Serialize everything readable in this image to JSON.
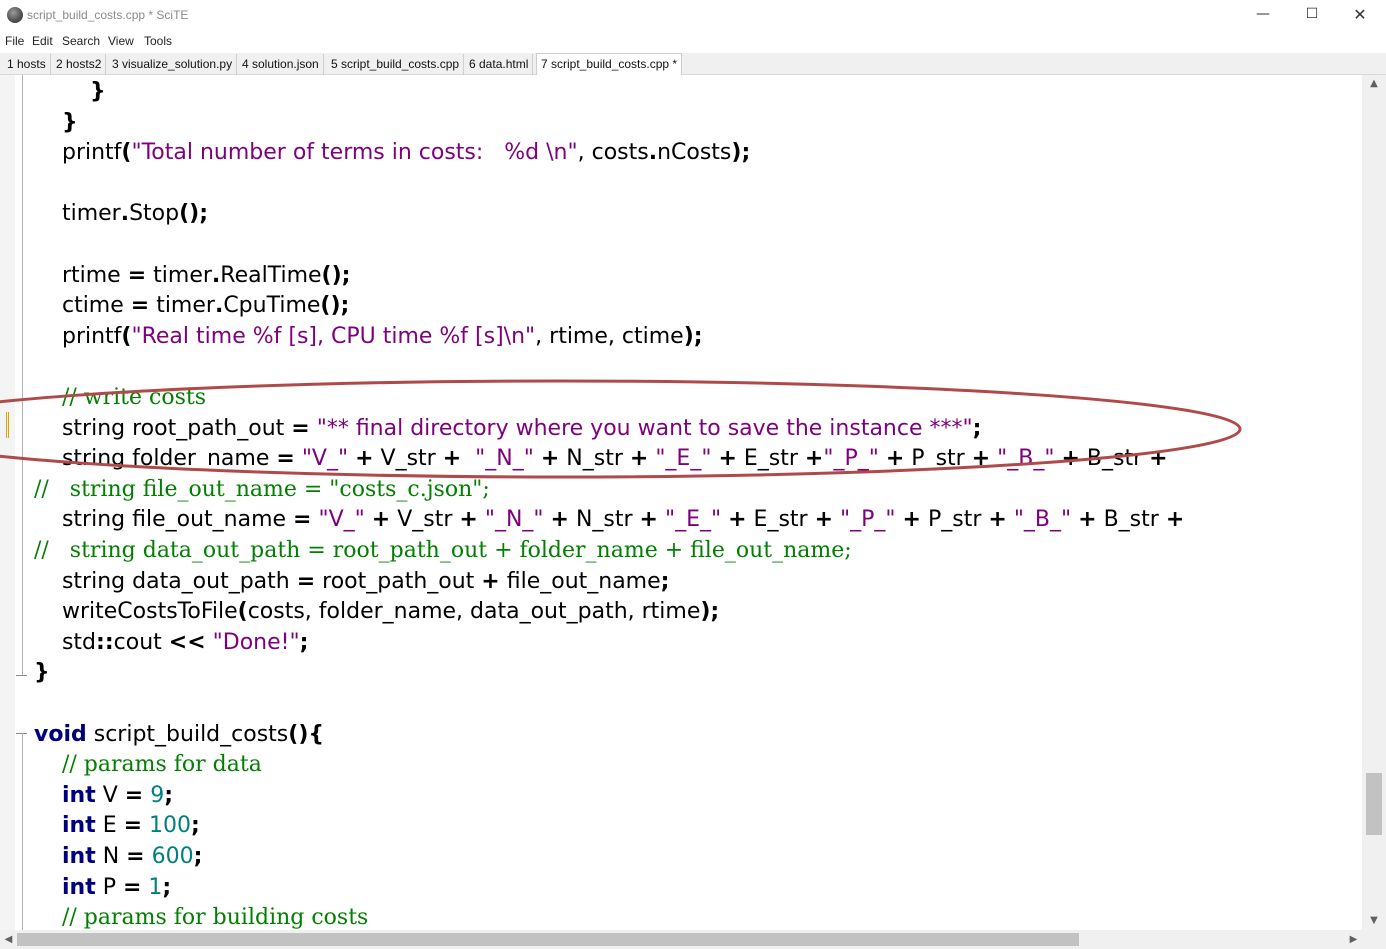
{
  "window": {
    "title": "script_build_costs.cpp * SciTE",
    "icon": "scite-icon",
    "minimize_glyph": "—",
    "maximize_glyph": "☐",
    "close_glyph": "✕"
  },
  "menu": [
    "File",
    "Edit",
    "Search",
    "View",
    "Tools"
  ],
  "tabs": [
    {
      "label": "1 hosts",
      "active": false
    },
    {
      "label": "2 hosts2",
      "active": false
    },
    {
      "label": "3 visualize_solution.py",
      "active": false
    },
    {
      "label": "4 solution.json",
      "active": false
    },
    {
      "label": "5 script_build_costs.cpp",
      "active": false
    },
    {
      "label": "6 data.html",
      "active": false
    },
    {
      "label": "7 script_build_costs.cpp *",
      "active": true
    }
  ],
  "colors": {
    "string": "#7f007f",
    "number": "#007f7f",
    "keyword": "#00007f",
    "comment": "#007f00",
    "annotation_ellipse": "#b04a4a"
  },
  "code": [
    [
      {
        "t": "        "
      },
      {
        "t": "}",
        "c": "op"
      }
    ],
    [
      {
        "t": "    "
      },
      {
        "t": "}",
        "c": "op"
      }
    ],
    [
      {
        "t": "    printf"
      },
      {
        "t": "(",
        "c": "op"
      },
      {
        "t": "\"Total number of terms in costs:   %d \\n\"",
        "c": "str"
      },
      {
        "t": ", costs"
      },
      {
        "t": ".",
        "c": "op"
      },
      {
        "t": "nCosts"
      },
      {
        "t": ");",
        "c": "op"
      }
    ],
    [
      {
        "t": ""
      }
    ],
    [
      {
        "t": "    timer"
      },
      {
        "t": ".",
        "c": "op"
      },
      {
        "t": "Stop"
      },
      {
        "t": "();",
        "c": "op"
      }
    ],
    [
      {
        "t": ""
      }
    ],
    [
      {
        "t": "    rtime "
      },
      {
        "t": "=",
        "c": "op"
      },
      {
        "t": " timer"
      },
      {
        "t": ".",
        "c": "op"
      },
      {
        "t": "RealTime"
      },
      {
        "t": "();",
        "c": "op"
      }
    ],
    [
      {
        "t": "    ctime "
      },
      {
        "t": "=",
        "c": "op"
      },
      {
        "t": " timer"
      },
      {
        "t": ".",
        "c": "op"
      },
      {
        "t": "CpuTime"
      },
      {
        "t": "();",
        "c": "op"
      }
    ],
    [
      {
        "t": "    printf"
      },
      {
        "t": "(",
        "c": "op"
      },
      {
        "t": "\"Real time %f [s], CPU time %f [s]\\n\"",
        "c": "str"
      },
      {
        "t": ", rtime, ctime"
      },
      {
        "t": ");",
        "c": "op"
      }
    ],
    [
      {
        "t": ""
      }
    ],
    [
      {
        "t": "    "
      },
      {
        "t": "// write costs",
        "c": "cmt"
      }
    ],
    [
      {
        "t": "    string root_path_out "
      },
      {
        "t": "=",
        "c": "op"
      },
      {
        "t": " "
      },
      {
        "t": "\"** final directory where you want to save the instance ***\"",
        "c": "str"
      },
      {
        "t": ";",
        "c": "op"
      }
    ],
    [
      {
        "t": "    string folder_name "
      },
      {
        "t": "=",
        "c": "op"
      },
      {
        "t": " "
      },
      {
        "t": "\"V_\"",
        "c": "str"
      },
      {
        "t": " "
      },
      {
        "t": "+",
        "c": "op"
      },
      {
        "t": " V_str "
      },
      {
        "t": "+",
        "c": "op"
      },
      {
        "t": "  "
      },
      {
        "t": "\"_N_\"",
        "c": "str"
      },
      {
        "t": " "
      },
      {
        "t": "+",
        "c": "op"
      },
      {
        "t": " N_str "
      },
      {
        "t": "+",
        "c": "op"
      },
      {
        "t": " "
      },
      {
        "t": "\"_E_\"",
        "c": "str"
      },
      {
        "t": " "
      },
      {
        "t": "+",
        "c": "op"
      },
      {
        "t": " E_str "
      },
      {
        "t": "+",
        "c": "op"
      },
      {
        "t": "\"_P_\"",
        "c": "str"
      },
      {
        "t": " "
      },
      {
        "t": "+",
        "c": "op"
      },
      {
        "t": " P_str "
      },
      {
        "t": "+",
        "c": "op"
      },
      {
        "t": " "
      },
      {
        "t": "\"_B_\"",
        "c": "str"
      },
      {
        "t": " "
      },
      {
        "t": "+",
        "c": "op"
      },
      {
        "t": " B_str "
      },
      {
        "t": "+",
        "c": "op"
      }
    ],
    [
      {
        "t": "//   string file_out_name = \"costs_c.json\";",
        "c": "cmt"
      }
    ],
    [
      {
        "t": "    string file_out_name "
      },
      {
        "t": "=",
        "c": "op"
      },
      {
        "t": " "
      },
      {
        "t": "\"V_\"",
        "c": "str"
      },
      {
        "t": " "
      },
      {
        "t": "+",
        "c": "op"
      },
      {
        "t": " V_str "
      },
      {
        "t": "+",
        "c": "op"
      },
      {
        "t": " "
      },
      {
        "t": "\"_N_\"",
        "c": "str"
      },
      {
        "t": " "
      },
      {
        "t": "+",
        "c": "op"
      },
      {
        "t": " N_str "
      },
      {
        "t": "+",
        "c": "op"
      },
      {
        "t": " "
      },
      {
        "t": "\"_E_\"",
        "c": "str"
      },
      {
        "t": " "
      },
      {
        "t": "+",
        "c": "op"
      },
      {
        "t": " E_str "
      },
      {
        "t": "+",
        "c": "op"
      },
      {
        "t": " "
      },
      {
        "t": "\"_P_\"",
        "c": "str"
      },
      {
        "t": " "
      },
      {
        "t": "+",
        "c": "op"
      },
      {
        "t": " P_str "
      },
      {
        "t": "+",
        "c": "op"
      },
      {
        "t": " "
      },
      {
        "t": "\"_B_\"",
        "c": "str"
      },
      {
        "t": " "
      },
      {
        "t": "+",
        "c": "op"
      },
      {
        "t": " B_str "
      },
      {
        "t": "+",
        "c": "op"
      }
    ],
    [
      {
        "t": "//   string data_out_path = root_path_out + folder_name + file_out_name;",
        "c": "cmt"
      }
    ],
    [
      {
        "t": "    string data_out_path "
      },
      {
        "t": "=",
        "c": "op"
      },
      {
        "t": " root_path_out "
      },
      {
        "t": "+",
        "c": "op"
      },
      {
        "t": " file_out_name"
      },
      {
        "t": ";",
        "c": "op"
      }
    ],
    [
      {
        "t": "    writeCostsToFile"
      },
      {
        "t": "(",
        "c": "op"
      },
      {
        "t": "costs, folder_name, data_out_path, rtime"
      },
      {
        "t": ");",
        "c": "op"
      }
    ],
    [
      {
        "t": "    std"
      },
      {
        "t": "::",
        "c": "op"
      },
      {
        "t": "cout "
      },
      {
        "t": "<<",
        "c": "op"
      },
      {
        "t": " "
      },
      {
        "t": "\"Done!\"",
        "c": "str"
      },
      {
        "t": ";",
        "c": "op"
      }
    ],
    [
      {
        "t": "}",
        "c": "op"
      }
    ],
    [
      {
        "t": ""
      }
    ],
    [
      {
        "t": "void",
        "c": "kw"
      },
      {
        "t": " script_build_costs"
      },
      {
        "t": "(){",
        "c": "op"
      }
    ],
    [
      {
        "t": "    "
      },
      {
        "t": "// params for data",
        "c": "cmt"
      }
    ],
    [
      {
        "t": "    "
      },
      {
        "t": "int",
        "c": "kw"
      },
      {
        "t": " V "
      },
      {
        "t": "=",
        "c": "op"
      },
      {
        "t": " "
      },
      {
        "t": "9",
        "c": "num"
      },
      {
        "t": ";",
        "c": "op"
      }
    ],
    [
      {
        "t": "    "
      },
      {
        "t": "int",
        "c": "kw"
      },
      {
        "t": " E "
      },
      {
        "t": "=",
        "c": "op"
      },
      {
        "t": " "
      },
      {
        "t": "100",
        "c": "num"
      },
      {
        "t": ";",
        "c": "op"
      }
    ],
    [
      {
        "t": "    "
      },
      {
        "t": "int",
        "c": "kw"
      },
      {
        "t": " N "
      },
      {
        "t": "=",
        "c": "op"
      },
      {
        "t": " "
      },
      {
        "t": "600",
        "c": "num"
      },
      {
        "t": ";",
        "c": "op"
      }
    ],
    [
      {
        "t": "    "
      },
      {
        "t": "int",
        "c": "kw"
      },
      {
        "t": " P "
      },
      {
        "t": "=",
        "c": "op"
      },
      {
        "t": " "
      },
      {
        "t": "1",
        "c": "num"
      },
      {
        "t": ";",
        "c": "op"
      }
    ],
    [
      {
        "t": "    "
      },
      {
        "t": "// params for building costs",
        "c": "cmt"
      }
    ]
  ]
}
